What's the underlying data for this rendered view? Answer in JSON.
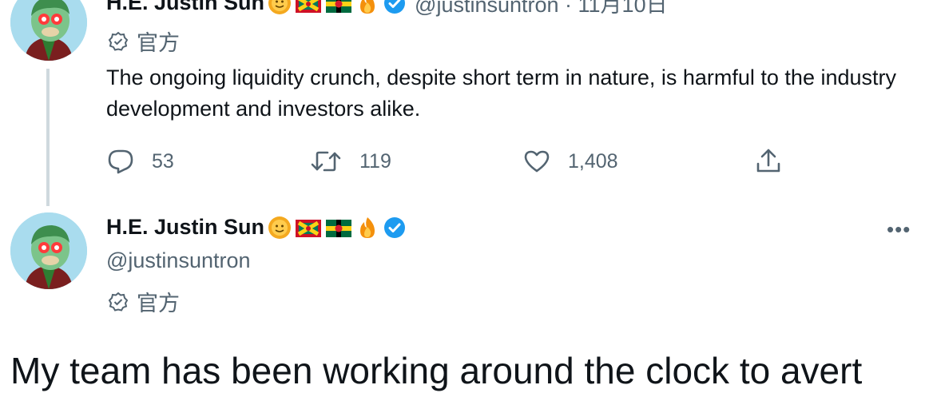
{
  "colors": {
    "verified": "#1d9bf0",
    "muted": "#536471",
    "thread_line": "#cfd9de",
    "avatar_bg": "#a9dcee"
  },
  "reply_tweet": {
    "display_name": "H.E. Justin Sun",
    "handle_and_date": "@justinsuntron · 11月10日",
    "label": "官方",
    "text": "The ongoing liquidity crunch, despite short term in nature, is harmful to the industry development and investors alike.",
    "reply_count": "53",
    "retweet_count": "119",
    "like_count": "1,408",
    "icons": [
      "reply-icon",
      "retweet-icon",
      "like-icon",
      "share-icon",
      "more-icon"
    ]
  },
  "main_tweet": {
    "display_name": "H.E. Justin Sun",
    "handle": "@justinsuntron",
    "label": "官方",
    "text": "My team has been working around the clock to avert"
  }
}
